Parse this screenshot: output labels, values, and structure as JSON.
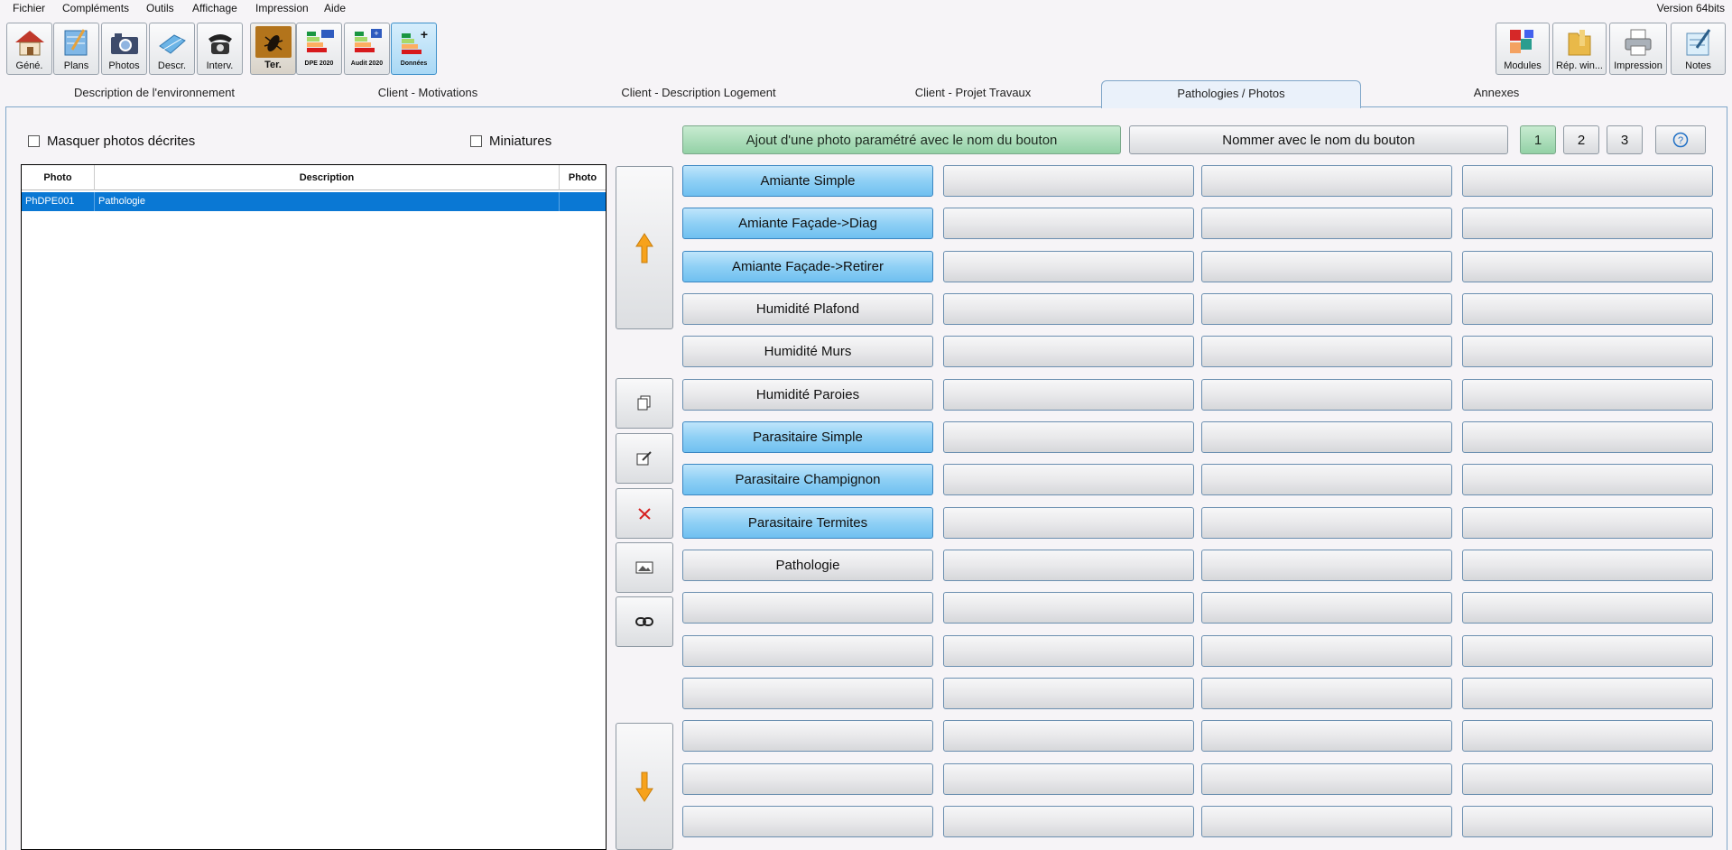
{
  "menu": {
    "items": [
      "Fichier",
      "Compléments",
      "Outils",
      "Affichage",
      "Impression",
      "Aide"
    ],
    "version": "Version 64bits"
  },
  "toolbar": {
    "left": [
      {
        "label": "Géné.",
        "icon": "house-icon"
      },
      {
        "label": "Plans",
        "icon": "plan-icon"
      },
      {
        "label": "Photos",
        "icon": "camera-icon"
      },
      {
        "label": "Descr.",
        "icon": "description-icon"
      },
      {
        "label": "Interv.",
        "icon": "phone-icon"
      },
      {
        "label": "Ter.",
        "icon": "termite-icon"
      },
      {
        "label": "DPE 2020",
        "icon": "energy-label-icon"
      },
      {
        "label": "Audit 2020",
        "icon": "energy-label-plus-icon"
      },
      {
        "label": "Données",
        "icon": "energy-data-icon"
      }
    ],
    "right": [
      {
        "label": "Modules",
        "icon": "puzzle-icon"
      },
      {
        "label": "Rép. win...",
        "icon": "folder-icon"
      },
      {
        "label": "Impression",
        "icon": "printer-icon"
      },
      {
        "label": "Notes",
        "icon": "notes-icon"
      }
    ]
  },
  "tabs": [
    "Description de l'environnement",
    "Client - Motivations",
    "Client - Description Logement",
    "Client - Projet Travaux",
    "Pathologies / Photos",
    "Annexes"
  ],
  "selected_tab": 4,
  "options": {
    "hide_described": "Masquer photos décrites",
    "thumbnails": "Miniatures"
  },
  "table": {
    "headers": [
      "Photo",
      "Description",
      "Photo"
    ],
    "rows": [
      {
        "photo": "PhDPE001",
        "description": "Pathologie",
        "photo2": ""
      }
    ]
  },
  "actions": {
    "add_photo": "Ajout d'une photo paramétré avec le nom du bouton",
    "rename": "Nommer avec le nom du bouton",
    "pages": [
      "1",
      "2",
      "3"
    ],
    "help_icon": "help-icon"
  },
  "grid": {
    "column0": [
      {
        "label": "Amiante Simple",
        "style": "blue"
      },
      {
        "label": "Amiante Façade->Diag",
        "style": "blue"
      },
      {
        "label": "Amiante Façade->Retirer",
        "style": "blue"
      },
      {
        "label": "Humidité Plafond",
        "style": "grey"
      },
      {
        "label": "Humidité Murs",
        "style": "grey"
      },
      {
        "label": "Humidité Paroies",
        "style": "grey"
      },
      {
        "label": "Parasitaire Simple",
        "style": "blue"
      },
      {
        "label": "Parasitaire Champignon",
        "style": "blue"
      },
      {
        "label": "Parasitaire Termites",
        "style": "blue"
      },
      {
        "label": "Pathologie",
        "style": "grey"
      },
      {
        "label": "",
        "style": "grey"
      },
      {
        "label": "",
        "style": "grey"
      },
      {
        "label": "",
        "style": "grey"
      },
      {
        "label": "",
        "style": "grey"
      },
      {
        "label": "",
        "style": "grey"
      },
      {
        "label": "",
        "style": "grey"
      }
    ]
  }
}
